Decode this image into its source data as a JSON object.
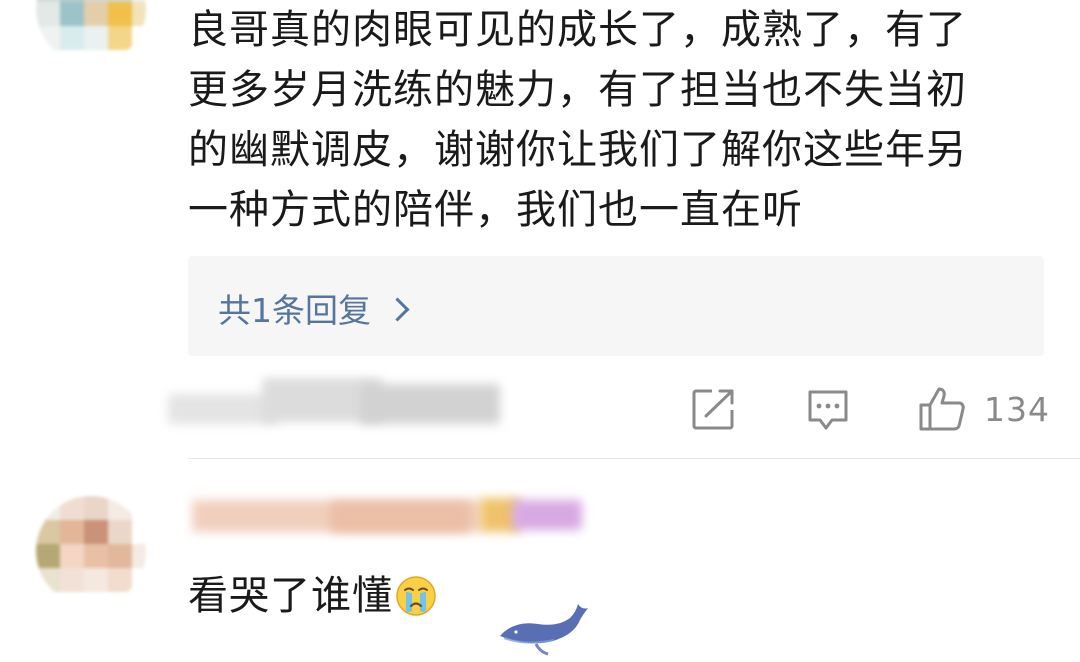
{
  "comment1": {
    "text_lines": [
      "良哥真的肉眼可见的成长了，成熟了，有了",
      "更多岁月洗练的魅力，有了担当也不失当初",
      "的幽默调皮，谢谢你让我们了解你这些年另",
      "一种方式的陪伴，我们也一直在听"
    ],
    "reply_link": "共1条回复",
    "like_count": "134"
  },
  "comment2": {
    "text": "看哭了谁懂"
  },
  "icons": {
    "share": "share-icon",
    "comment": "comment-icon",
    "like": "thumbs-up-icon",
    "reply_chevron": "chevron-right-icon",
    "emoji": "crying-face-emoji-icon",
    "watermark": "whale-watermark-icon"
  },
  "colors": {
    "text": "#1a1a1a",
    "link": "#56759c",
    "icon_gray": "#8a8a8a",
    "reply_bg": "#f6f6f6"
  }
}
